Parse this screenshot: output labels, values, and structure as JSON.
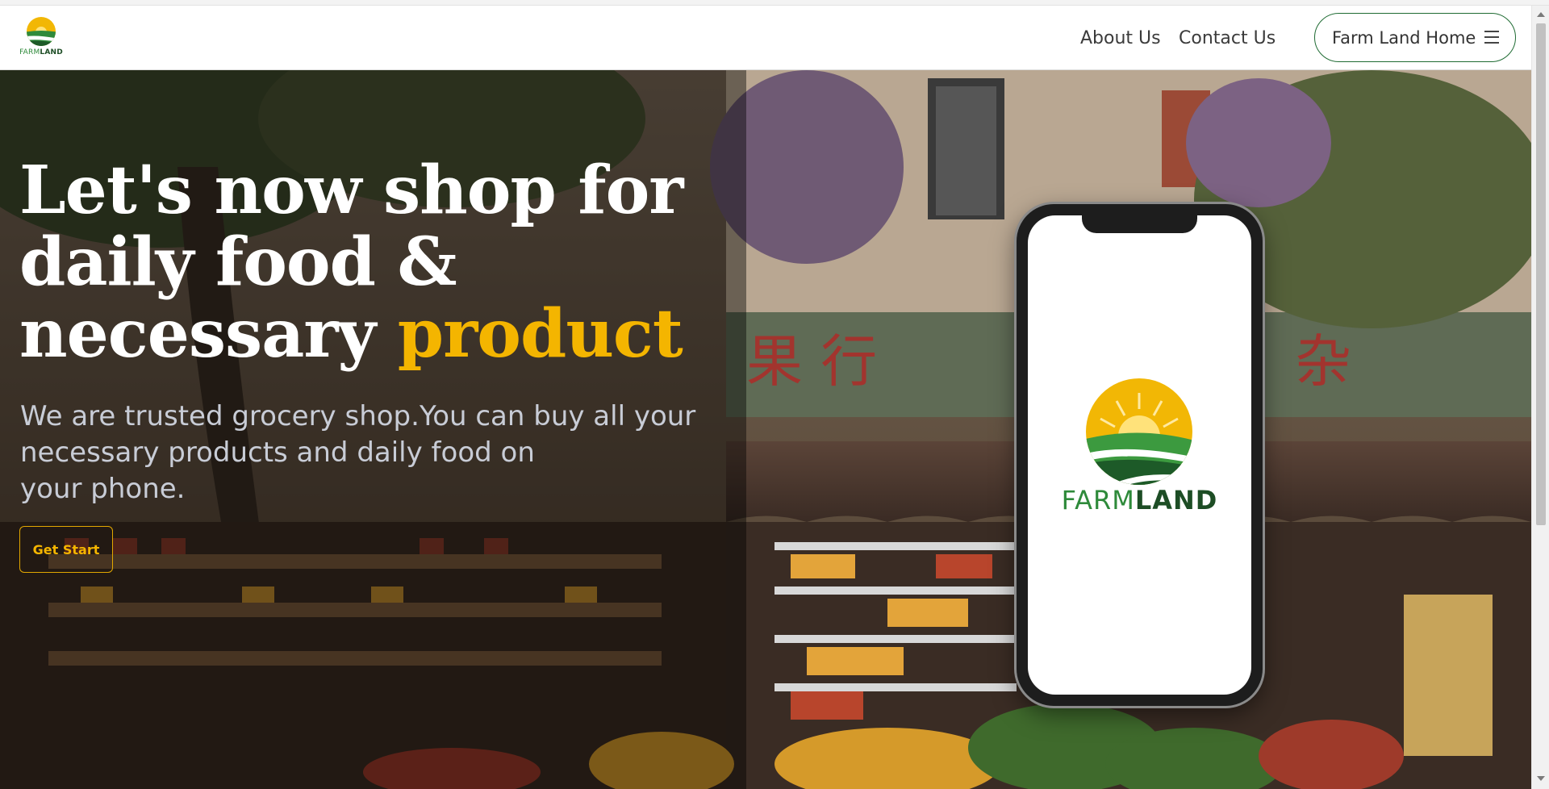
{
  "header": {
    "brand_farm": "FARM",
    "brand_land": "LAND",
    "nav": [
      {
        "label": "About Us"
      },
      {
        "label": "Contact Us"
      }
    ],
    "home_button_label": "Farm Land Home"
  },
  "hero": {
    "headline_line1": "Let's now shop for",
    "headline_line2": "daily food &",
    "headline_line3_plain": "necessary ",
    "headline_line3_accent": "product",
    "subtext_line1": "We are trusted grocery shop.You can buy all your",
    "subtext_line2": "necessary products and daily food on",
    "subtext_line3": "your phone.",
    "cta_label": "Get Start",
    "phone_brand_farm": "FARM",
    "phone_brand_land": "LAND"
  },
  "colors": {
    "accent": "#f4b500",
    "brand_green": "#2e8a3a",
    "brand_dark_green": "#1d4d25"
  },
  "icons": {
    "logo": "farmland-logo-icon",
    "menu": "hamburger-menu-icon"
  }
}
